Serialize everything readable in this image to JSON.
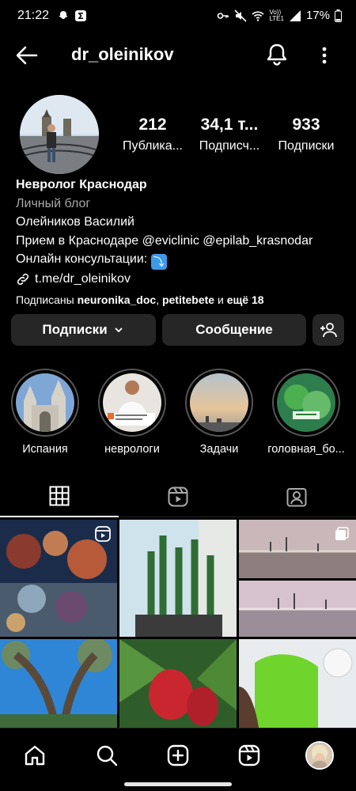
{
  "status_bar": {
    "time": "21:22",
    "battery": "17%",
    "network_lines": [
      "Vo))",
      "LTE1"
    ],
    "left_icons": [
      "snapchat-icon",
      "sigma-icon"
    ],
    "right_icons": [
      "key-icon",
      "mute-icon",
      "wifi-icon",
      "signal-icon",
      "battery-icon"
    ]
  },
  "header": {
    "username": "dr_oleinikov",
    "icons": [
      "back-arrow-icon",
      "bell-icon",
      "more-vertical-icon"
    ]
  },
  "stats": [
    {
      "number": "212",
      "label": "Публика..."
    },
    {
      "number": "34,1 т...",
      "label": "Подписч..."
    },
    {
      "number": "933",
      "label": "Подписки"
    }
  ],
  "bio": {
    "name": "Невролог Краснодар",
    "category": "Личный блог",
    "line1": "Олейников Василий",
    "line2": "Прием в Краснодаре @eviclinic @epilab_krasnodar",
    "line3": "Онлайн консультации:",
    "line3_emoji": "⤵",
    "link": "t.me/dr_oleinikov",
    "followed_prefix": "Подписаны",
    "followed_user1": "neuronika_doc",
    "followed_sep": ",",
    "followed_user2": "petitebete",
    "followed_and": "и",
    "followed_more": "ещё 18"
  },
  "buttons": {
    "subscriptions": "Подписки",
    "message": "Сообщение"
  },
  "highlights": [
    {
      "label": "Испания"
    },
    {
      "label": "неврологи"
    },
    {
      "label": "Задачи"
    },
    {
      "label": "головная_бо..."
    }
  ],
  "tabs": [
    "grid-icon",
    "reels-icon",
    "tagged-icon"
  ],
  "nav": [
    "home-icon",
    "search-icon",
    "create-icon",
    "reels-icon",
    "profile-avatar"
  ],
  "colors": {
    "background": "#000000",
    "button_bg": "#262626",
    "secondary_text": "#a8a8a8",
    "emoji_blue": "#3d9ae8"
  }
}
